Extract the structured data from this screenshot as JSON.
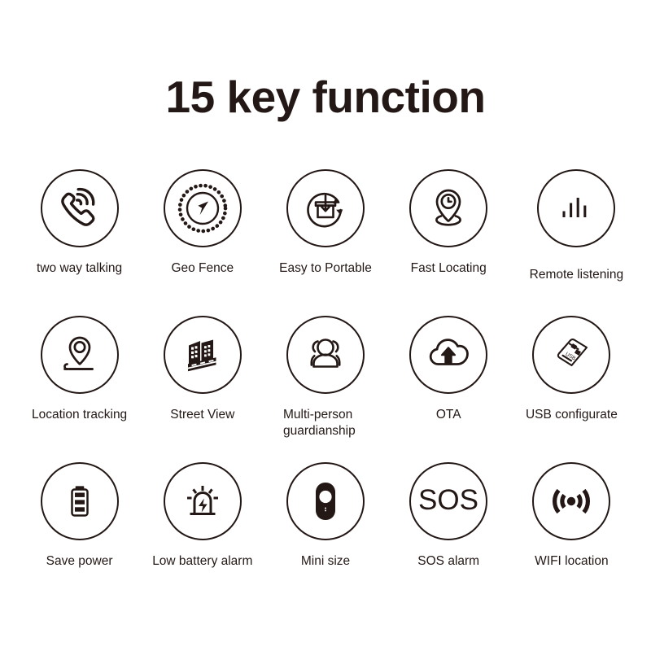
{
  "page": {
    "title": "15 key function",
    "background_color": "#ffffff",
    "ink_color": "#231815"
  },
  "features": [
    {
      "id": "two-way-talking",
      "label": "two way talking",
      "icon": "phone-call-icon",
      "row": 1,
      "col": 1
    },
    {
      "id": "geo-fence",
      "label": "Geo Fence",
      "icon": "compass-fence-icon",
      "row": 1,
      "col": 2
    },
    {
      "id": "easy-to-portable",
      "label": "Easy to Portable",
      "icon": "box-download-cycle-icon",
      "row": 1,
      "col": 3
    },
    {
      "id": "fast-locating",
      "label": "Fast Locating",
      "icon": "pin-clock-icon",
      "row": 1,
      "col": 4
    },
    {
      "id": "remote-listening",
      "label": "Remote listening",
      "icon": "audio-bars-icon",
      "row": 1,
      "col": 5
    },
    {
      "id": "location-tracking",
      "label": "Location tracking",
      "icon": "pin-road-icon",
      "row": 2,
      "col": 1
    },
    {
      "id": "street-view",
      "label": "Street View",
      "icon": "buildings-road-icon",
      "row": 2,
      "col": 2
    },
    {
      "id": "multi-person-guardianship",
      "label": "Multi-person guardianship",
      "icon": "people-group-icon",
      "row": 2,
      "col": 3
    },
    {
      "id": "ota",
      "label": "OTA",
      "icon": "cloud-upload-icon",
      "row": 2,
      "col": 4
    },
    {
      "id": "usb-configurate",
      "label": "USB configurate",
      "icon": "usb-dongle-icon",
      "row": 2,
      "col": 5
    },
    {
      "id": "save-power",
      "label": "Save power",
      "icon": "battery-icon",
      "row": 3,
      "col": 1
    },
    {
      "id": "low-battery-alarm",
      "label": "Low battery alarm",
      "icon": "siren-bolt-icon",
      "row": 3,
      "col": 2
    },
    {
      "id": "mini-size",
      "label": "Mini size",
      "icon": "mini-device-icon",
      "row": 3,
      "col": 3
    },
    {
      "id": "sos-alarm",
      "label": "SOS alarm",
      "icon": "sos-text-icon",
      "row": 3,
      "col": 4
    },
    {
      "id": "wifi-location",
      "label": "WIFI location",
      "icon": "wifi-signal-icon",
      "row": 3,
      "col": 5
    }
  ],
  "icon_text": {
    "usb_label": "USB",
    "sos_label": "SOS"
  }
}
